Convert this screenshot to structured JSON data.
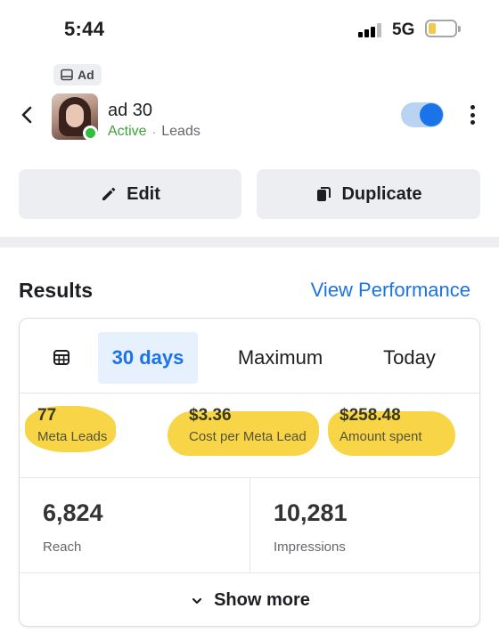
{
  "status_bar": {
    "time": "5:44",
    "network": "5G",
    "battery_level_fraction": 0.2,
    "battery_color": "#f2c94c"
  },
  "ad_badge": {
    "label": "Ad",
    "icon": "ad-icon"
  },
  "header": {
    "back_icon": "chevron-left-icon",
    "ad_name": "ad 30",
    "status": "Active",
    "separator": "·",
    "objective": "Leads",
    "status_color": "#3ca33a",
    "toggle_on": true,
    "more_icon": "vertical-dots-icon"
  },
  "actions": {
    "edit_label": "Edit",
    "edit_icon": "pencil-icon",
    "duplicate_label": "Duplicate",
    "duplicate_icon": "copy-icon"
  },
  "results": {
    "title": "Results",
    "view_performance": "View Performance",
    "tabs": [
      {
        "label": "30 days",
        "active": true
      },
      {
        "label": "Maximum",
        "active": false
      },
      {
        "label": "Today",
        "active": false
      }
    ],
    "calendar_icon": "calendar-icon",
    "metrics": [
      {
        "value": "77",
        "label": "Meta Leads"
      },
      {
        "value": "$3.36",
        "label": "Cost per Meta Lead"
      },
      {
        "value": "$258.48",
        "label": "Amount spent"
      }
    ],
    "stats": [
      {
        "value": "6,824",
        "label": "Reach"
      },
      {
        "value": "10,281",
        "label": "Impressions"
      }
    ],
    "show_more": "Show more",
    "accent_color": "#1a73e8",
    "highlight_color": "#f7d033"
  }
}
